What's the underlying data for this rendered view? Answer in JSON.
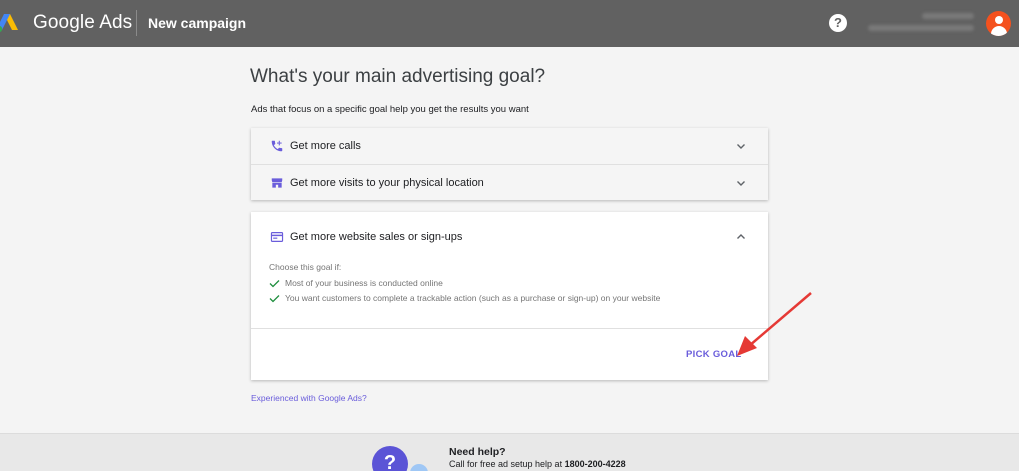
{
  "header": {
    "brand": "Google Ads",
    "page_name": "New campaign",
    "help_icon": "?"
  },
  "main": {
    "title": "What's your main advertising goal?",
    "subtitle": "Ads that focus on a specific goal help you get the results you want",
    "goals": [
      {
        "label": "Get more calls",
        "icon": "phone-icon",
        "expanded": false
      },
      {
        "label": "Get more visits to your physical location",
        "icon": "store-icon",
        "expanded": false
      },
      {
        "label": "Get more website sales or sign-ups",
        "icon": "web-icon",
        "expanded": true
      }
    ],
    "expanded": {
      "choose_title": "Choose this goal if:",
      "criteria": [
        "Most of your business is conducted online",
        "You want customers to complete a trackable action (such as a purchase or sign-up) on your website"
      ],
      "pick_label": "PICK GOAL"
    },
    "experienced_link": "Experienced with Google Ads?"
  },
  "footer": {
    "need_help": "Need help?",
    "call_prefix": "Call for free ad setup help at ",
    "phone": "1800-200-4228",
    "help_glyph": "?"
  },
  "colors": {
    "header_bg": "#616161",
    "accent": "#6a5ddb",
    "check": "#1e8e3e",
    "avatar": "#f4511e",
    "annotation_arrow": "#e53935"
  }
}
